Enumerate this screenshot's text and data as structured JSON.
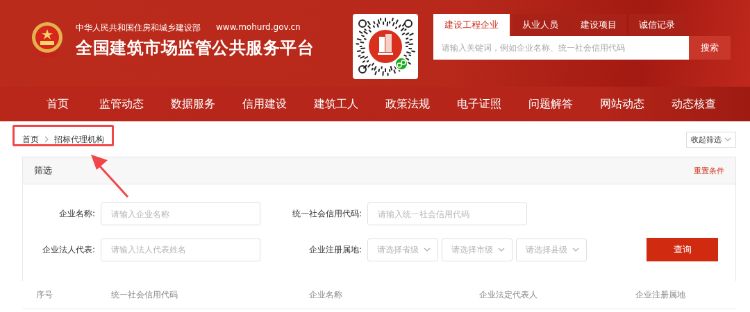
{
  "header": {
    "ministry": "中华人民共和国住房和城乡建设部",
    "url": "www.mohurd.gov.cn",
    "title": "全国建筑市场监管公共服务平台"
  },
  "search": {
    "tabs": [
      {
        "label": "建设工程企业",
        "selected": true
      },
      {
        "label": "从业人员",
        "selected": false
      },
      {
        "label": "建设项目",
        "selected": false
      },
      {
        "label": "诚信记录",
        "selected": false
      }
    ],
    "placeholder": "请输入关键词，例如企业名称、统一社会信用代码",
    "button": "搜索"
  },
  "nav": [
    "首页",
    "监管动态",
    "数据服务",
    "信用建设",
    "建筑工人",
    "政策法规",
    "电子证照",
    "问题解答",
    "网站动态",
    "动态核查"
  ],
  "breadcrumb": [
    "首页",
    "招标代理机构"
  ],
  "collapse_button": "收起筛选",
  "filter": {
    "title": "筛选",
    "reset": "重置条件",
    "fields": [
      {
        "label": "企业名称:",
        "placeholder": "请输入企业名称"
      },
      {
        "label": "统一社会信用代码:",
        "placeholder": "请输入统一社会信用代码"
      },
      {
        "label": "企业法人代表:",
        "placeholder": "请输入法人代表姓名"
      }
    ],
    "region": {
      "label": "企业注册属地:",
      "selects": [
        "请选择省级",
        "请选择市级",
        "请选择县级"
      ]
    },
    "query_button": "查询"
  },
  "table": {
    "columns": [
      "序号",
      "统一社会信用代码",
      "企业名称",
      "企业法定代表人",
      "企业注册属地"
    ]
  }
}
